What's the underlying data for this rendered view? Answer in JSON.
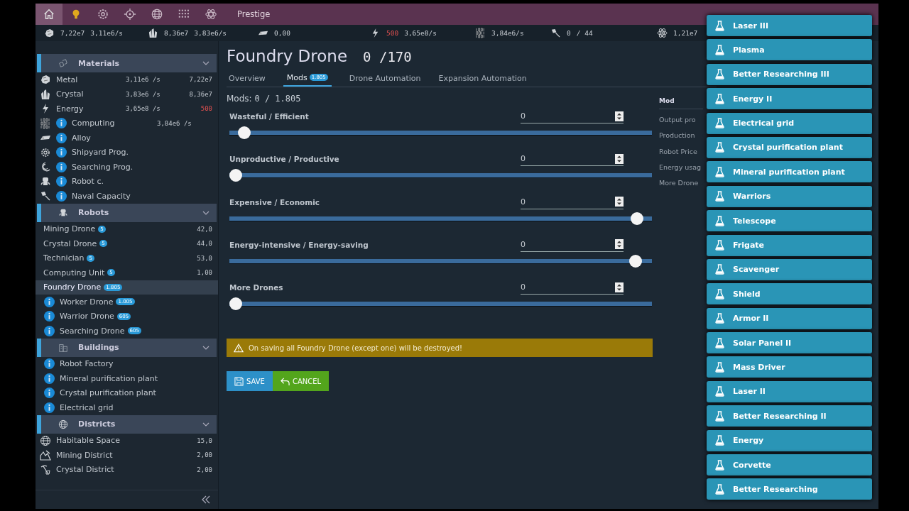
{
  "nav": {
    "tabs": [
      {
        "kind": "home",
        "selected": true
      },
      {
        "kind": "bulb",
        "selected": false
      },
      {
        "kind": "gear",
        "selected": false
      },
      {
        "kind": "target",
        "selected": false
      },
      {
        "kind": "globe",
        "selected": false
      },
      {
        "kind": "grid",
        "selected": false
      },
      {
        "kind": "atom",
        "selected": false
      },
      {
        "kind": "text",
        "label": "Prestige",
        "selected": false
      }
    ]
  },
  "resource_bar": [
    {
      "kind": "metal",
      "amount": "7,22e7",
      "rate": "3,11e6/s"
    },
    {
      "kind": "crystal",
      "amount": "8,36e7",
      "rate": "3,83e6/s"
    },
    {
      "kind": "alloy",
      "amount": "0,00"
    },
    {
      "kind": "energy",
      "amount": "500",
      "low": true,
      "rate": "3,65e8/s"
    },
    {
      "kind": "computing",
      "rate": "3,84e6/s"
    },
    {
      "kind": "naval",
      "amount": "0",
      "max": "/ 44"
    },
    {
      "kind": "atom",
      "amount": "1,21e7"
    }
  ],
  "sidebar": {
    "sections": [
      {
        "title": "Materials",
        "expanded": true,
        "items": [
          {
            "name": "Metal",
            "info": false,
            "rate": "3,11e6 /s",
            "amount": "7,22e7",
            "low": false
          },
          {
            "name": "Crystal",
            "info": false,
            "rate": "3,83e6 /s",
            "amount": "8,36e7",
            "low": false
          },
          {
            "name": "Energy",
            "info": false,
            "rate": "3,65e8 /s",
            "amount": "500",
            "low": true
          },
          {
            "name": "Computing",
            "info": true,
            "rate": "3,84e6 /s"
          },
          {
            "name": "Alloy",
            "info": true
          },
          {
            "name": "Shipyard Prog.",
            "info": true
          },
          {
            "name": "Searching Prog.",
            "info": true
          },
          {
            "name": "Robot c.",
            "info": true
          },
          {
            "name": "Naval Capacity",
            "info": true
          }
        ]
      },
      {
        "title": "Robots",
        "expanded": true,
        "items": [
          {
            "name": "Mining Drone",
            "info": false,
            "badge": "5",
            "amount": "42,0",
            "selected": false
          },
          {
            "name": "Crystal Drone",
            "info": false,
            "badge": "5",
            "amount": "44,0",
            "selected": false
          },
          {
            "name": "Technician",
            "info": false,
            "badge": "5",
            "amount": "53,0",
            "selected": false
          },
          {
            "name": "Computing Unit",
            "info": false,
            "badge": "5",
            "amount": "1,00",
            "selected": false
          },
          {
            "name": "Foundry Drone",
            "info": false,
            "badge": "1.805",
            "selected": true
          },
          {
            "name": "Worker Drone",
            "info": true,
            "badge": "1.005",
            "selected": false
          },
          {
            "name": "Warrior Drone",
            "info": true,
            "badge": "605",
            "selected": false
          },
          {
            "name": "Searching Drone",
            "info": true,
            "badge": "605",
            "selected": false
          }
        ]
      },
      {
        "title": "Buildings",
        "expanded": true,
        "items": [
          {
            "name": "Robot Factory",
            "info": true
          },
          {
            "name": "Mineral purification plant",
            "info": true
          },
          {
            "name": "Crystal purification plant",
            "info": true
          },
          {
            "name": "Electrical grid",
            "info": true
          }
        ]
      },
      {
        "title": "Districts",
        "expanded": true,
        "items": [
          {
            "name": "Habitable Space",
            "info": false,
            "amount": "15,0"
          },
          {
            "name": "Mining District",
            "info": false,
            "amount": "2,00"
          },
          {
            "name": "Crystal District",
            "info": false,
            "amount": "2,00"
          }
        ]
      }
    ]
  },
  "main": {
    "title": "Foundry Drone",
    "count": "0 /170",
    "tabs": [
      {
        "label": "Overview",
        "selected": false
      },
      {
        "label": "Mods",
        "badge": "1.805",
        "selected": true
      },
      {
        "label": "Drone Automation",
        "selected": false
      },
      {
        "label": "Expansion Automation",
        "selected": false
      }
    ],
    "mods_label": "Mods:",
    "mods_value": "0 / 1.805",
    "sliders": [
      {
        "label": "Wasteful / Efficient",
        "value": "0",
        "level": 0.02
      },
      {
        "label": "Unproductive / Productive",
        "value": "0",
        "level": 0.0
      },
      {
        "label": "Expensive / Economic",
        "value": "0",
        "level": 0.98
      },
      {
        "label": "Energy-intensive / Energy-saving",
        "value": "0",
        "level": 0.975
      },
      {
        "label": "More Drones",
        "value": "0",
        "level": 0.0
      }
    ],
    "warning": "On saving all Foundry Drone (except one) will be destroyed!",
    "buttons": [
      {
        "kind": "save",
        "label": "SAVE"
      },
      {
        "kind": "cancel",
        "label": "CANCEL"
      }
    ],
    "mod_table": {
      "header": "Mod",
      "rows": [
        "Output pro",
        "Production",
        "Robot Price",
        "Energy usag",
        "More Drone"
      ]
    }
  },
  "notifications": [
    "Laser III",
    "Plasma",
    "Better Researching III",
    "Energy II",
    "Electrical grid",
    "Crystal purification plant",
    "Mineral purification plant",
    "Warriors",
    "Telescope",
    "Frigate",
    "Scavenger",
    "Shield",
    "Armor II",
    "Solar Panel II",
    "Mass Driver",
    "Laser II",
    "Better Researching II",
    "Energy",
    "Corvette",
    "Better Researching"
  ]
}
